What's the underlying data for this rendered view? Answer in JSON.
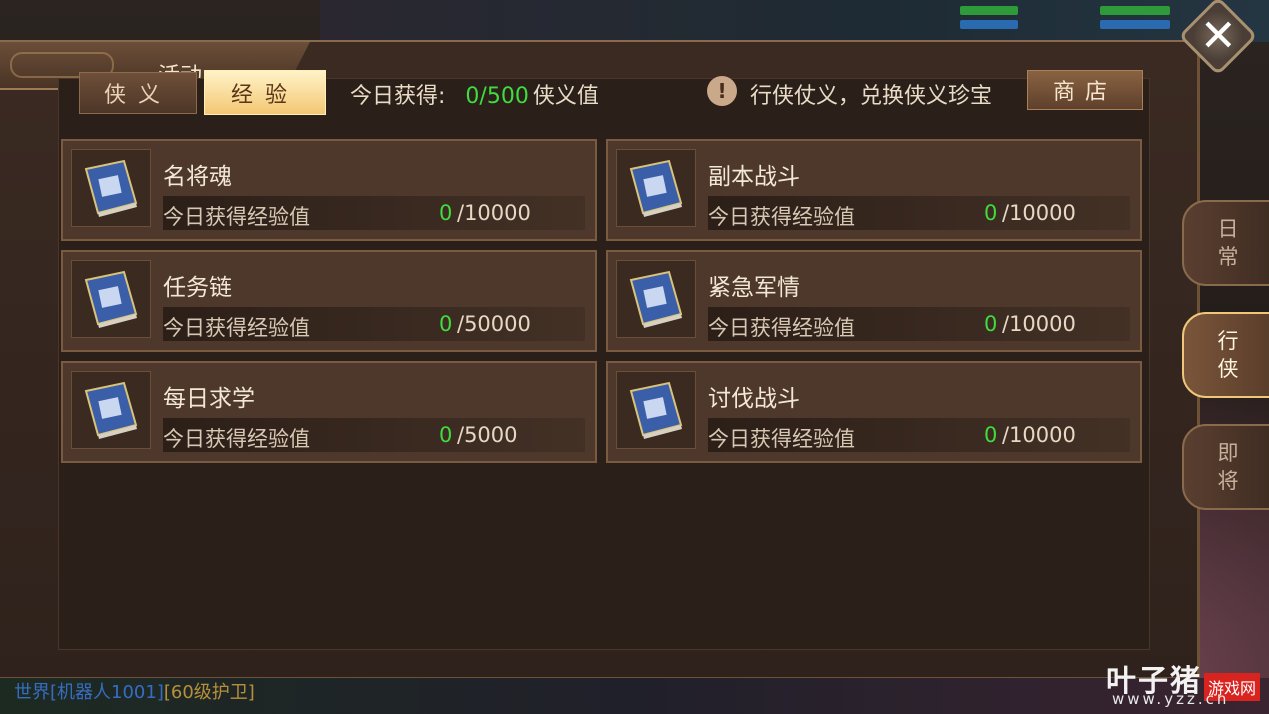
{
  "window": {
    "title": "活动",
    "close_symbol": "✕"
  },
  "tabs": [
    {
      "label": "侠义",
      "active": false
    },
    {
      "label": "经验",
      "active": true
    }
  ],
  "header": {
    "earned_label": "今日获得:",
    "earned_value": "0/500",
    "earned_unit": "侠义值",
    "notice_symbol": "!",
    "notice_text": "行侠仗义，兑换侠义珍宝",
    "shop_label": "商店"
  },
  "cards": [
    {
      "name": "名将魂",
      "label": "今日获得经验值",
      "current": "0",
      "max": "/10000",
      "icon": "book-icon"
    },
    {
      "name": "副本战斗",
      "label": "今日获得经验值",
      "current": "0",
      "max": "/10000",
      "icon": "book-icon"
    },
    {
      "name": "任务链",
      "label": "今日获得经验值",
      "current": "0",
      "max": "/50000",
      "icon": "book-icon"
    },
    {
      "name": "紧急军情",
      "label": "今日获得经验值",
      "current": "0",
      "max": "/10000",
      "icon": "book-icon"
    },
    {
      "name": "每日求学",
      "label": "今日获得经验值",
      "current": "0",
      "max": "/5000",
      "icon": "book-icon"
    },
    {
      "name": "讨伐战斗",
      "label": "今日获得经验值",
      "current": "0",
      "max": "/10000",
      "icon": "book-icon"
    }
  ],
  "side_tabs": [
    {
      "line1": "日",
      "line2": "常",
      "active": false
    },
    {
      "line1": "行",
      "line2": "侠",
      "active": true
    },
    {
      "line1": "即",
      "line2": "将",
      "active": false
    }
  ],
  "chat": {
    "channel": "世界",
    "sender": "[机器人1001]",
    "message": "[60级护卫]"
  },
  "watermark": {
    "main": "叶子猪",
    "badge": "游戏网",
    "url": "www.yzz.cn"
  },
  "colors": {
    "accent_green": "#3fdc3f",
    "tab_active": "#f3c773",
    "panel_bg": "#2b1f1a"
  }
}
